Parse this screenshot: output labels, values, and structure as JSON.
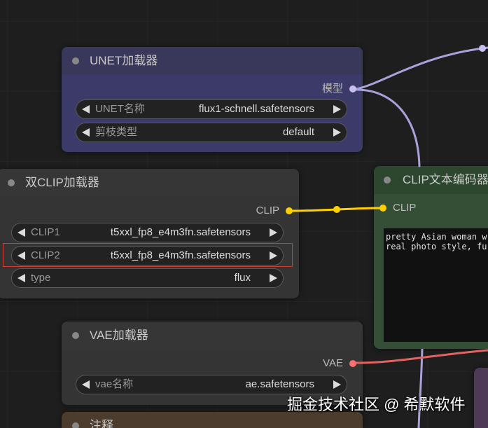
{
  "node_colors": {
    "unet_title": "#39385b",
    "unet_body": "#3c3a68",
    "default_title": "#363636",
    "default_body": "#343434",
    "green_title": "#2d472e",
    "green_body": "#354e36",
    "note_title": "#4b3c2d",
    "purple_body": "#4e3a57"
  },
  "colors": {
    "model": "#aaa1dc",
    "model_slot": "#c6bff0",
    "clip": "#ffd000",
    "vae": "#e36262",
    "vae_slot": "#ff7070",
    "title_dot": "#888888",
    "highlight": "#d93a30",
    "textarea_bg": "#111111"
  },
  "icons": {
    "title_dot": "collapse-dot-icon",
    "combo_prev": "arrow-left-icon",
    "combo_next": "arrow-right-icon",
    "slot": "slot-dot-icon"
  },
  "nodes": {
    "unet_loader": {
      "title": "UNET加载器",
      "output_label": "模型",
      "widgets": [
        {
          "label": "UNET名称",
          "value": "flux1-schnell.safetensors"
        },
        {
          "label": "剪枝类型",
          "value": "default"
        }
      ]
    },
    "dual_clip_loader": {
      "title": "双CLIP加载器",
      "output_label": "CLIP",
      "widgets": [
        {
          "label": "CLIP1",
          "value": "t5xxl_fp8_e4m3fn.safetensors"
        },
        {
          "label": "CLIP2",
          "value": "t5xxl_fp8_e4m3fn.safetensors"
        },
        {
          "label": "type",
          "value": "flux"
        }
      ]
    },
    "clip_text_encode": {
      "title": "CLIP文本编码器",
      "input_label": "CLIP",
      "prompt_lines": [
        "pretty Asian woman w",
        "real photo style, fu"
      ]
    },
    "vae_loader": {
      "title": "VAE加载器",
      "output_label": "VAE",
      "widgets": [
        {
          "label": "vae名称",
          "value": "ae.safetensors"
        }
      ]
    },
    "note": {
      "title": "注释"
    }
  },
  "watermark": "掘金技术社区 @ 希默软件"
}
